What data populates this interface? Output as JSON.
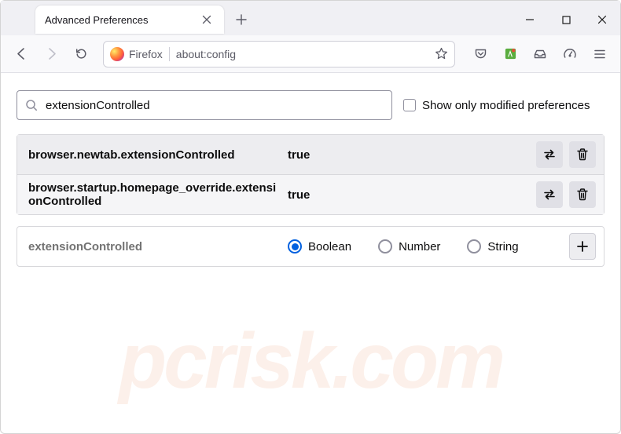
{
  "titlebar": {
    "tab_title": "Advanced Preferences"
  },
  "toolbar": {
    "identity_label": "Firefox",
    "url": "about:config"
  },
  "search": {
    "value": "extensionControlled",
    "checkbox_label": "Show only modified preferences"
  },
  "prefs": {
    "row1": {
      "name": "browser.newtab.extensionControlled",
      "value": "true"
    },
    "row2": {
      "name": "browser.startup.homepage_override.extensionControlled",
      "value": "true"
    }
  },
  "add": {
    "name": "extensionControlled",
    "options": {
      "boolean": "Boolean",
      "number": "Number",
      "string": "String"
    }
  },
  "watermark": "pcrisk.com"
}
